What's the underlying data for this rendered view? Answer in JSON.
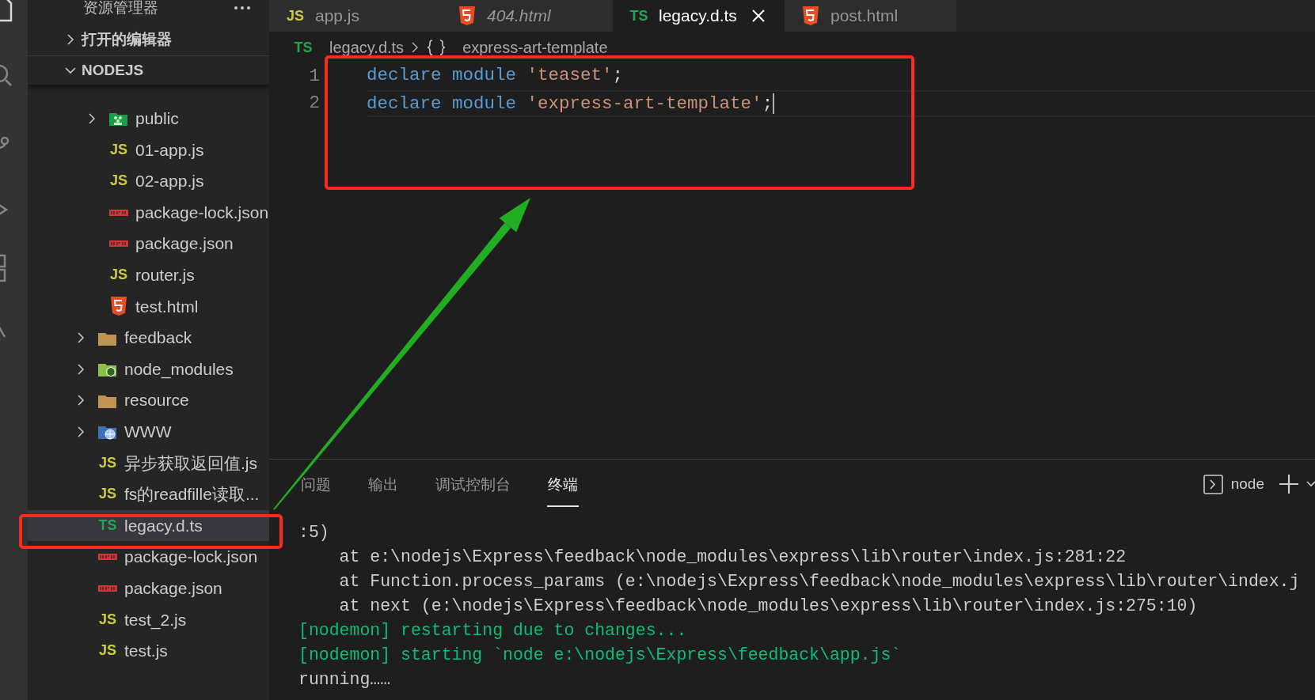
{
  "sidebar": {
    "title": "资源管理器",
    "sections": [
      {
        "label": "打开的编辑器",
        "expanded": false
      },
      {
        "label": "NODEJS",
        "expanded": true
      }
    ],
    "tree": [
      {
        "children": [
          {
            "label": "public",
            "kind": "public-folder",
            "expanded": false,
            "selected": false
          },
          {
            "label": "01-app.js",
            "kind": "js",
            "badge": "JS",
            "selected": false
          },
          {
            "label": "02-app.js",
            "kind": "js",
            "badge": "JS",
            "selected": false
          },
          {
            "label": "package-lock.json",
            "kind": "npm",
            "selected": false
          },
          {
            "label": "package.json",
            "kind": "npm",
            "selected": false
          },
          {
            "label": "router.js",
            "kind": "js",
            "badge": "JS",
            "selected": false
          },
          {
            "label": "test.html",
            "kind": "html",
            "selected": false
          }
        ]
      },
      {
        "label": "feedback",
        "kind": "folder",
        "expanded": false,
        "selected": false
      },
      {
        "label": "node_modules",
        "kind": "node-folder",
        "expanded": false,
        "selected": false
      },
      {
        "label": "resource",
        "kind": "folder",
        "expanded": false,
        "selected": false
      },
      {
        "label": "WWW",
        "kind": "www-folder",
        "expanded": false,
        "selected": false
      },
      {
        "label": "异步获取返回值.js",
        "kind": "js",
        "badge": "JS",
        "selected": false
      },
      {
        "label": "fs的readfille读取...",
        "kind": "js",
        "badge": "JS",
        "selected": false
      },
      {
        "label": "legacy.d.ts",
        "kind": "ts",
        "badge": "TS",
        "selected": true
      },
      {
        "label": "package-lock.json",
        "kind": "npm",
        "selected": false
      },
      {
        "label": "package.json",
        "kind": "npm",
        "selected": false
      },
      {
        "label": "test_2.js",
        "kind": "js",
        "badge": "JS",
        "selected": false
      },
      {
        "label": "test.js",
        "kind": "js",
        "badge": "JS",
        "selected": false
      }
    ]
  },
  "tabs": [
    {
      "label": "app.js",
      "kind": "js",
      "badge": "JS",
      "selected": false,
      "preview": false
    },
    {
      "label": "404.html",
      "kind": "html",
      "selected": false,
      "preview": true
    },
    {
      "label": "legacy.d.ts",
      "kind": "ts",
      "badge": "TS",
      "selected": true,
      "preview": false
    },
    {
      "label": "post.html",
      "kind": "html",
      "selected": false,
      "preview": false
    }
  ],
  "breadcrumb": [
    {
      "label": "legacy.d.ts",
      "kind": "ts",
      "badge": "TS"
    },
    {
      "label": "express-art-template",
      "kind": "module"
    }
  ],
  "code_lines": [
    {
      "number": "1",
      "current": false,
      "tokens": [
        {
          "kind": "keyword",
          "text": "declare"
        },
        {
          "kind": "keyword",
          "text": "module"
        },
        {
          "kind": "string",
          "text": "'teaset'"
        },
        {
          "kind": "punctuation",
          "text": ";"
        }
      ]
    },
    {
      "number": "2",
      "current": true,
      "tokens": [
        {
          "kind": "keyword",
          "text": "declare"
        },
        {
          "kind": "keyword",
          "text": "module"
        },
        {
          "kind": "string",
          "text": "'express-art-template'"
        },
        {
          "kind": "punctuation",
          "text": ";"
        }
      ]
    }
  ],
  "panel": {
    "tabs": [
      {
        "label": "问题",
        "selected": false
      },
      {
        "label": "输出",
        "selected": false
      },
      {
        "label": "调试控制台",
        "selected": false
      },
      {
        "label": "终端",
        "selected": true
      }
    ],
    "terminal_name": "node",
    "lines": [
      {
        "kind": "plain",
        "text": ":5)"
      },
      {
        "kind": "plain",
        "text": "    at e:\\nodejs\\Express\\feedback\\node_modules\\express\\lib\\router\\index.js:281:22"
      },
      {
        "kind": "plain",
        "text": "    at Function.process_params (e:\\nodejs\\Express\\feedback\\node_modules\\express\\lib\\router\\index.j"
      },
      {
        "kind": "plain",
        "text": "    at next (e:\\nodejs\\Express\\feedback\\node_modules\\express\\lib\\router\\index.js:275:10)"
      },
      {
        "kind": "nodemon",
        "text": "[nodemon] restarting due to changes..."
      },
      {
        "kind": "nodemon",
        "text": "[nodemon] starting `node e:\\nodejs\\Express\\feedback\\app.js`"
      },
      {
        "kind": "plain",
        "text": "running……"
      }
    ]
  }
}
